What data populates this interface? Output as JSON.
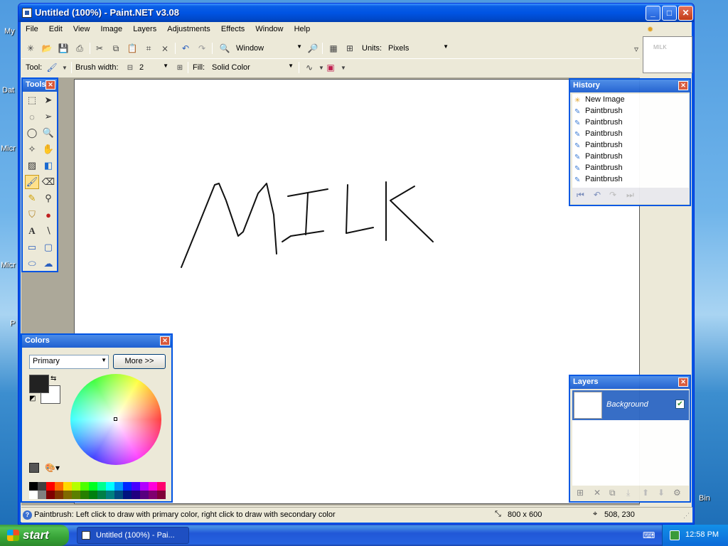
{
  "window": {
    "title": "Untitled (100%) - Paint.NET v3.08"
  },
  "desktop": {
    "labels": [
      "My",
      "Dat",
      "Micr",
      "Micr",
      "P",
      "Bin"
    ]
  },
  "menu": [
    "File",
    "Edit",
    "View",
    "Image",
    "Layers",
    "Adjustments",
    "Effects",
    "Window",
    "Help"
  ],
  "toolbar": {
    "zoom_mode": "Window",
    "units_label": "Units:",
    "units_value": "Pixels",
    "tool_label": "Tool:",
    "brush_width_label": "Brush width:",
    "brush_width_value": "2",
    "fill_label": "Fill:",
    "fill_value": "Solid Color"
  },
  "thumbnail": {
    "text": "MILK"
  },
  "canvas": {
    "drawing_text": "MILK"
  },
  "tools_panel": {
    "title": "Tools",
    "selected": "paintbrush",
    "tools": [
      "rectangle-select",
      "move-selection",
      "lasso-select",
      "move-selected",
      "ellipse-select",
      "zoom",
      "magic-wand",
      "pan",
      "paint-bucket",
      "gradient",
      "paintbrush",
      "eraser",
      "pencil",
      "color-picker",
      "clone-stamp",
      "recolor",
      "text",
      "line-curve",
      "rectangle",
      "rounded-rectangle",
      "ellipse",
      "freeform-shape"
    ]
  },
  "history_panel": {
    "title": "History",
    "items": [
      "New Image",
      "Paintbrush",
      "Paintbrush",
      "Paintbrush",
      "Paintbrush",
      "Paintbrush",
      "Paintbrush",
      "Paintbrush"
    ]
  },
  "colors_panel": {
    "title": "Colors",
    "mode": "Primary",
    "more_label": "More >>",
    "primary_color": "#222222",
    "secondary_color": "#ffffff",
    "palette": [
      "#000000",
      "#404040",
      "#ff0000",
      "#ff6a00",
      "#ffd800",
      "#b6ff00",
      "#4cff00",
      "#00ff21",
      "#00ff90",
      "#00ffff",
      "#0094ff",
      "#0026ff",
      "#4800ff",
      "#b200ff",
      "#ff00dc",
      "#ff006e",
      "#ffffff",
      "#808080",
      "#7f0000",
      "#7f3300",
      "#7f6a00",
      "#5b7f00",
      "#267f00",
      "#007f0e",
      "#007f46",
      "#007f7f",
      "#004a7f",
      "#00137f",
      "#21007f",
      "#57007f",
      "#7f006e",
      "#7f0037"
    ]
  },
  "layers_panel": {
    "title": "Layers",
    "layers": [
      {
        "name": "Background",
        "visible": true
      }
    ]
  },
  "status": {
    "help_text": "Paintbrush: Left click to draw with primary color, right click to draw with secondary color",
    "image_size": "800 x 600",
    "cursor_position": "508, 230"
  },
  "taskbar": {
    "start_label": "start",
    "task_label": "Untitled (100%) - Pai...",
    "clock": "12:58 PM"
  }
}
